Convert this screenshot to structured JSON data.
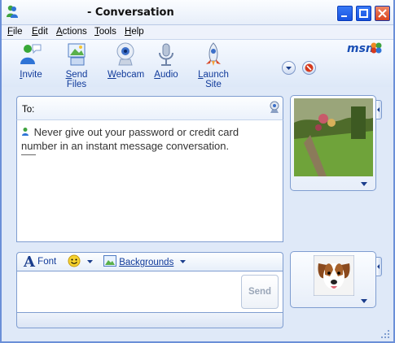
{
  "window": {
    "title": "- Conversation",
    "controls": [
      "minimize",
      "maximize",
      "close"
    ]
  },
  "menu": {
    "items": [
      "File",
      "Edit",
      "Actions",
      "Tools",
      "Help"
    ]
  },
  "toolbar": {
    "items": [
      {
        "label": "Invite",
        "icon": "invite-icon"
      },
      {
        "label": "Send Files",
        "icon": "send-files-icon"
      },
      {
        "label": "Webcam",
        "icon": "webcam-icon"
      },
      {
        "label": "Audio",
        "icon": "audio-icon"
      },
      {
        "label": "Launch Site",
        "icon": "launch-site-icon"
      }
    ],
    "brand": "msn"
  },
  "conversation": {
    "to_label": "To:",
    "warning_message": "Never give out your password or credit card number in an instant message conversation."
  },
  "compose": {
    "font_label": "Font",
    "backgrounds_label": "Backgrounds",
    "send_label": "Send",
    "input_value": ""
  },
  "colors": {
    "accent": "#103a9a",
    "panel_border": "#7f9dd0",
    "window_bg": "#dfe9f8"
  }
}
